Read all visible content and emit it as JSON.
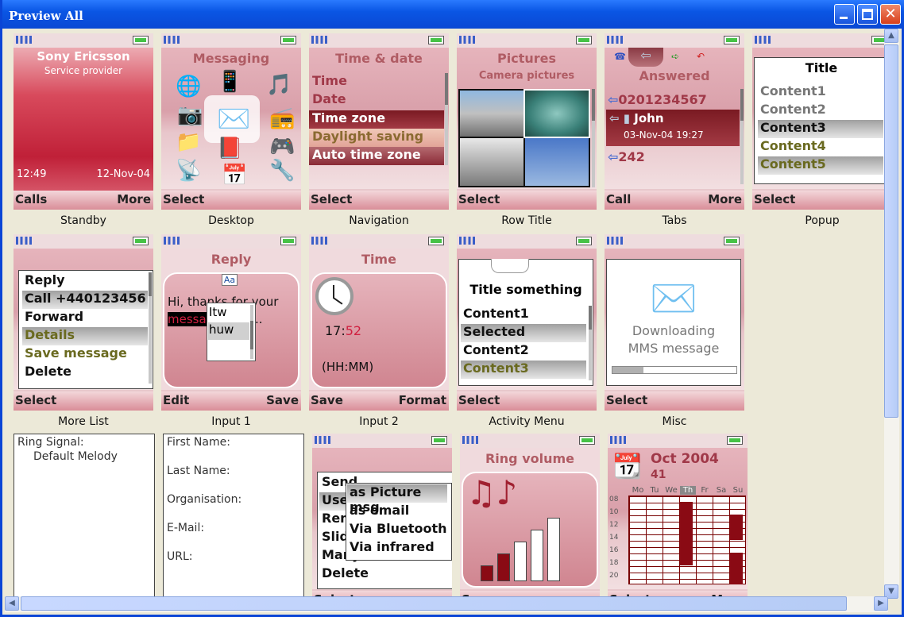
{
  "window": {
    "title": "Preview All"
  },
  "standby": {
    "brand": "Sony Ericsson",
    "provider": "Service provider",
    "time": "12:49",
    "date": "12-Nov-04",
    "left": "Calls",
    "right": "More",
    "caption": "Standby"
  },
  "desktop": {
    "title": "Messaging",
    "left": "Select",
    "caption": "Desktop"
  },
  "navigation": {
    "title": "Time & date",
    "items": [
      "Time",
      "Date",
      "Time zone",
      "Daylight saving",
      "Auto time zone"
    ],
    "left": "Select",
    "caption": "Navigation"
  },
  "rowtitle": {
    "title": "Pictures",
    "subtitle": "Camera pictures",
    "left": "Select",
    "caption": "Row Title"
  },
  "tabs": {
    "title": "Answered",
    "rows": [
      "0201234567",
      "John",
      "03-Nov-04 19:27",
      "242"
    ],
    "left": "Call",
    "right": "More",
    "caption": "Tabs"
  },
  "popup": {
    "title": "Title",
    "items": [
      "Content1",
      "Content2",
      "Content3",
      "Content4",
      "Content5"
    ],
    "left": "Select",
    "caption": "Popup"
  },
  "morelist": {
    "items": [
      "Reply",
      "Call +440123456",
      "Forward",
      "Details",
      "Save message",
      "Delete"
    ],
    "left": "Select",
    "caption": "More List"
  },
  "input1": {
    "title": "Reply",
    "mode": "Aa",
    "line1": "Hi, thanks for your",
    "line2a": "messa",
    "line2b": "..",
    "options": [
      "Itw",
      "huw"
    ],
    "left": "Edit",
    "right": "Save",
    "caption": "Input 1"
  },
  "input2": {
    "title": "Time",
    "hh": "17:",
    "mm": "52",
    "fmt": "(HH:MM)",
    "left": "Save",
    "right": "Format",
    "caption": "Input 2"
  },
  "activity": {
    "title": "Title something",
    "items": [
      "Content1",
      "Selected",
      "Content2",
      "Content3"
    ],
    "left": "Select",
    "caption": "Activity Menu"
  },
  "misc": {
    "line1": "Downloading",
    "line2": "MMS message",
    "progress": 0.25,
    "left": "Select",
    "caption": "Misc"
  },
  "ringsignal": {
    "label": "Ring Signal:",
    "value": "Default Melody"
  },
  "contact": {
    "fields": [
      "First Name:",
      "Last Name:",
      "Organisation:",
      "E-Mail:",
      "URL:"
    ]
  },
  "sendmenu": {
    "items": [
      "Send",
      "Use",
      "Rem",
      "Slide",
      "Many",
      "Delete"
    ],
    "sub": [
      "as Picture msg",
      "as email",
      "Via Bluetooth",
      "Via infrared"
    ],
    "left": "Select"
  },
  "ringvol": {
    "title": "Ring volume",
    "levels": [
      0.2,
      0.35,
      0.5,
      0.65,
      0.8
    ],
    "left": "Save"
  },
  "calendar": {
    "month": "Oct 2004",
    "week": "41",
    "days": [
      "Mo",
      "Tu",
      "We",
      "Th",
      "Fr",
      "Sa",
      "Su"
    ],
    "hours": [
      "08",
      "10",
      "12",
      "14",
      "16",
      "18",
      "20"
    ],
    "left": "Select",
    "right": "More"
  }
}
